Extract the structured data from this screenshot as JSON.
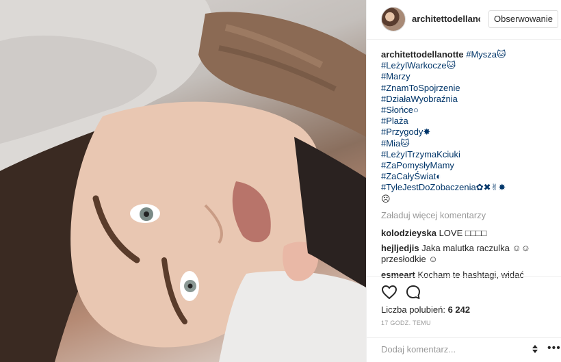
{
  "post": {
    "author": "architettodellanotte",
    "author_short": "architettodellanc",
    "follow_label": "Obserwowanie",
    "caption_hashtags": [
      "#Mysza🐱",
      "#LeżyIWarkocze🐱",
      "#Marzy",
      "#ZnamToSpojrzenie",
      "#DziałaWyobraźnia",
      "#Słońce○",
      "#Plaża",
      "#Przygody✸",
      "#Mia🐱",
      "#LeżyITrzymaKciuki",
      "#ZaPomysłyMamy",
      "#ZaCałyŚwiat◐",
      "#TyleJestDoZobaczenia✿✖✌✸",
      "☹"
    ],
    "load_more": "Załaduj więcej komentarzy",
    "comments": [
      {
        "author": "kolodzieyska",
        "text": "LOVE □□□□"
      },
      {
        "author": "hejljedjis",
        "text": "Jaka malutka raczulka ☺☺ przesłodkie ☺"
      },
      {
        "author": "esmeart",
        "text": "Kocham te hashtagi, widać"
      }
    ],
    "likes_label": "Liczba polubień:",
    "likes_count": "6 242",
    "time_ago": "17 GODZ. TEMU",
    "comment_placeholder": "Dodaj komentarz...",
    "more_icon": "•••"
  },
  "icons": {
    "heart": "heart-icon",
    "comment": "comment-bubble-icon"
  },
  "colors": {
    "hashtag": "#003569",
    "muted": "#999999",
    "text": "#262626",
    "border": "#efefef"
  }
}
